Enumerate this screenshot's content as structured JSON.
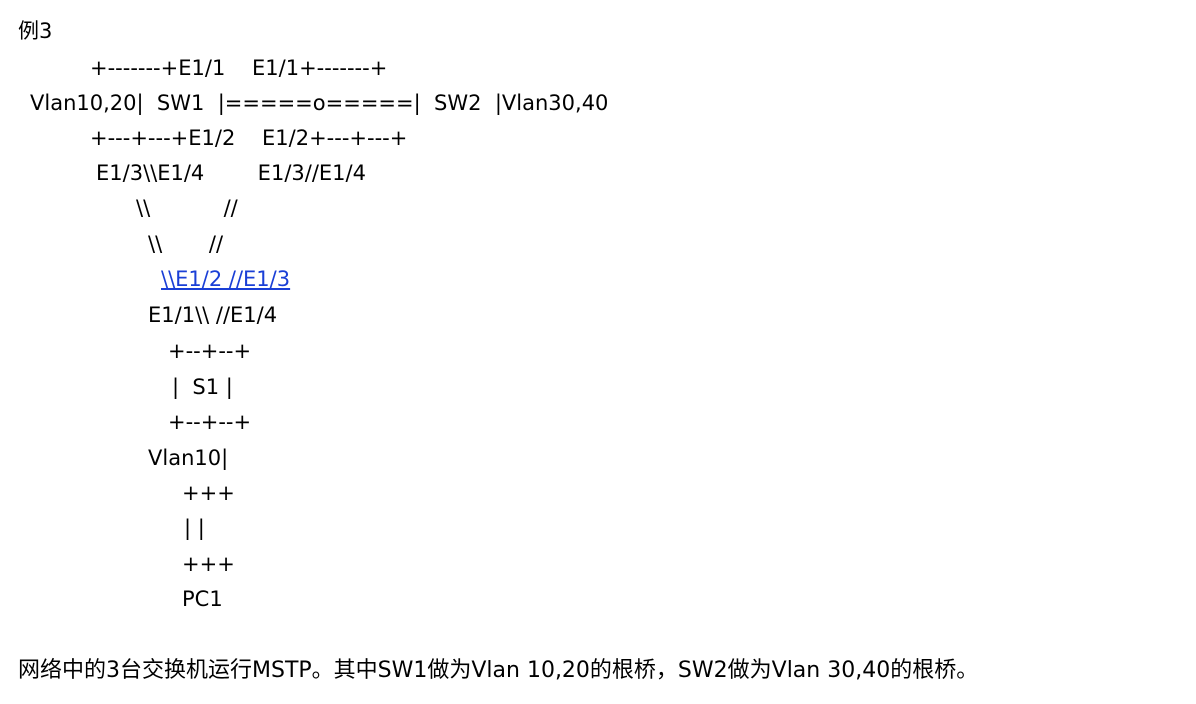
{
  "title": "例3",
  "diagram_lines": [
    "+-------+E1/1    E1/1+-------+",
    "Vlan10,20|  SW1  |=====o=====|  SW2  |Vlan30,40",
    "+---+---+E1/2    E1/2+---+---+",
    "E1/3\\\\E1/4        E1/3//E1/4",
    "\\\\           //",
    "\\\\       //",
    "\\\\E1/2 //E1/3",
    "E1/1\\\\ //E1/4",
    "+--+--+",
    "|  S1 |",
    "+--+--+",
    "Vlan10|",
    "+++",
    "| |",
    "+++",
    "PC1"
  ],
  "caption": "网络中的3台交换机运行MSTP。其中SW1做为Vlan 10,20的根桥，SW2做为Vlan 30,40的根桥。",
  "colors": {
    "link": "#1a3fd6"
  }
}
